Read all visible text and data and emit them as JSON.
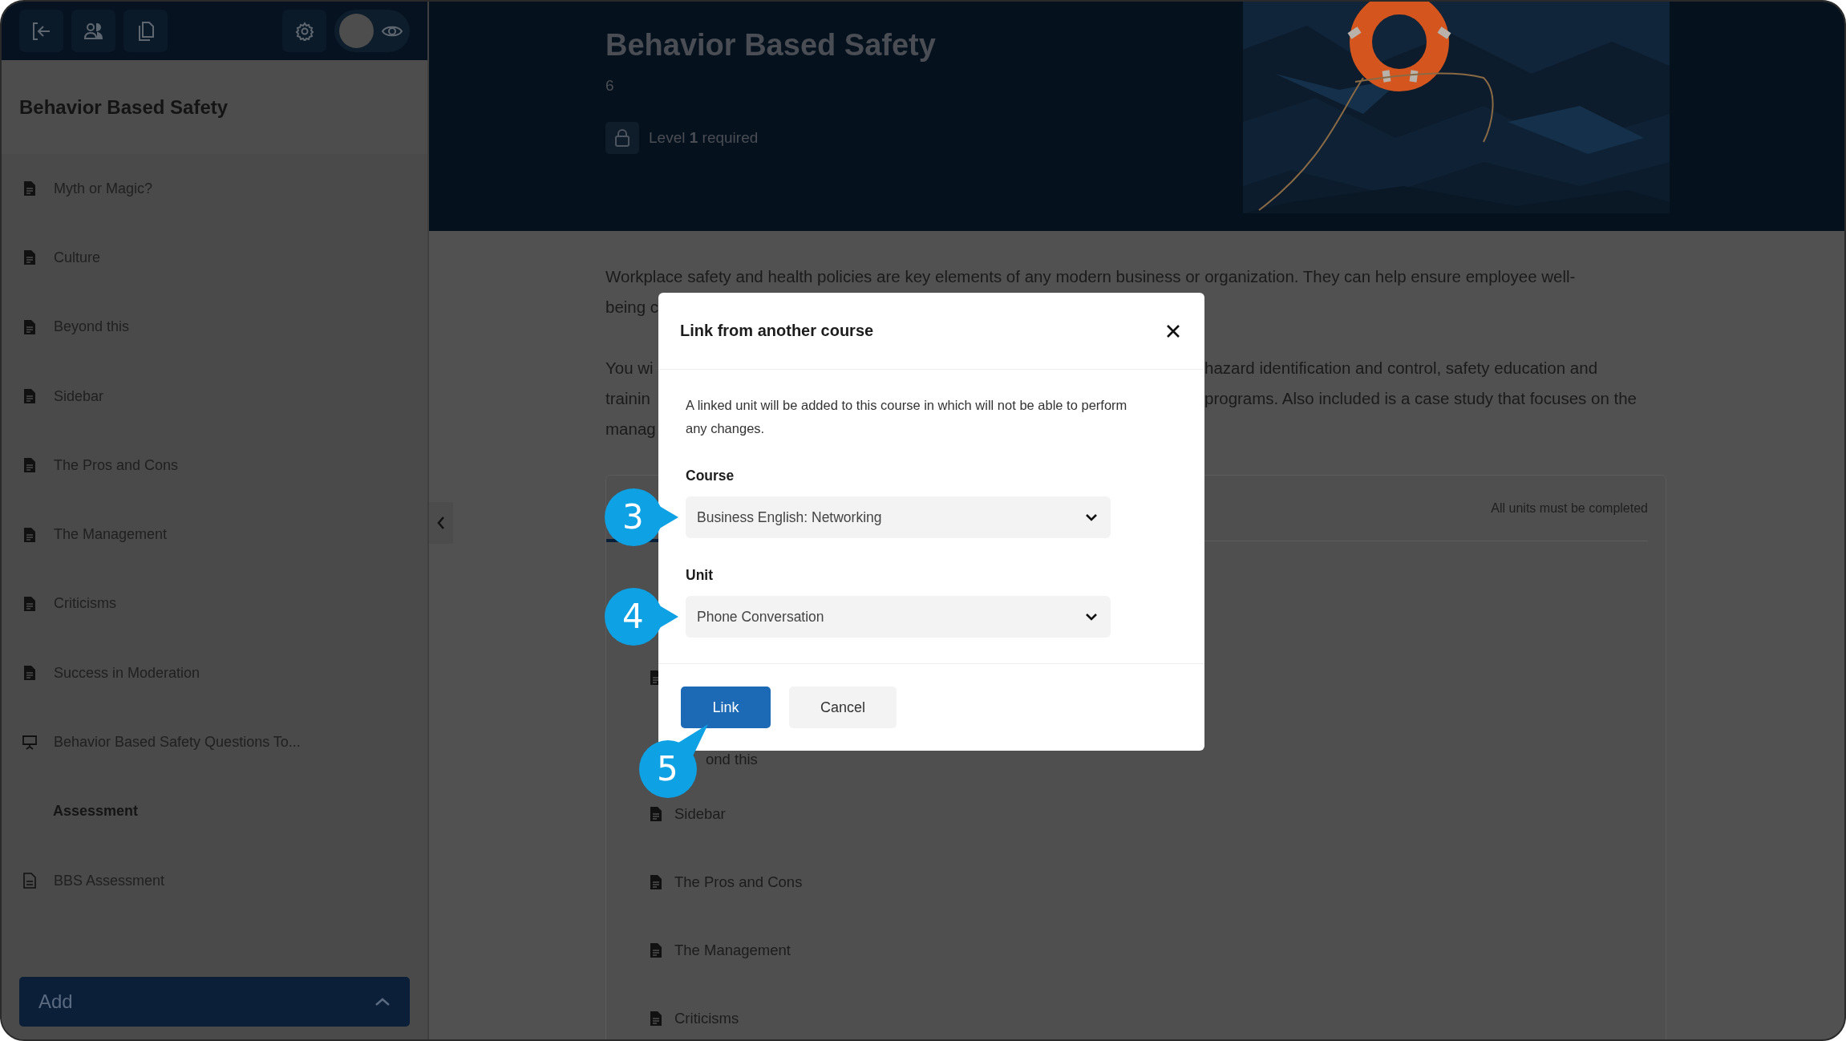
{
  "toolbar": {
    "preview_toggle": {
      "on": false
    }
  },
  "sidebar": {
    "title": "Behavior Based Safety",
    "items": [
      {
        "label": "Myth or Magic?",
        "kind": "page"
      },
      {
        "label": "Culture",
        "kind": "page"
      },
      {
        "label": "Beyond this",
        "kind": "page"
      },
      {
        "label": "Sidebar",
        "kind": "page"
      },
      {
        "label": "The Pros and Cons",
        "kind": "page"
      },
      {
        "label": "The Management",
        "kind": "page"
      },
      {
        "label": "Criticisms",
        "kind": "page"
      },
      {
        "label": "Success in Moderation",
        "kind": "page"
      },
      {
        "label": "Behavior Based Safety Questions To...",
        "kind": "presentation"
      },
      {
        "label": "Assessment",
        "kind": "heading"
      },
      {
        "label": "BBS Assessment",
        "kind": "assessment"
      }
    ],
    "add_button": "Add"
  },
  "banner": {
    "title": "Behavior Based Safety",
    "count": "6",
    "requirement": "Level **1** required"
  },
  "paragraphs": [
    [
      {
        "start": "Workplace safety and health policies are key elements of any modern business or organization. They can help ensure employee well-"
      },
      {
        "start": "being c"
      }
    ],
    [
      {
        "start": "You wi",
        "end": "hazard identification and control, safety education and"
      },
      {
        "start": "trainin",
        "end": "programs. Also included is a case study that focuses on the"
      },
      {
        "start": "manag"
      }
    ]
  ],
  "course_card": {
    "status": "All units must be completed",
    "units": [
      {
        "kind": "page"
      },
      {
        "kind": "page",
        "label": "ond this",
        "covered": true
      },
      {
        "kind": "page",
        "label": "Sidebar"
      },
      {
        "kind": "page",
        "label": "The Pros and Cons"
      },
      {
        "kind": "page",
        "label": "The Management"
      },
      {
        "kind": "page",
        "label": "Criticisms"
      }
    ]
  },
  "dialog": {
    "title": "Link from another course",
    "description": "A linked unit will be added to this course in which will not be able to perform any changes.",
    "fields": [
      {
        "label": "Course",
        "value": "Business English: Networking",
        "callout": "3"
      },
      {
        "label": "Unit",
        "value": "Phone Conversation",
        "callout": "4"
      }
    ],
    "buttons": [
      {
        "label": "Link",
        "kind": "primary",
        "callout": "5"
      },
      {
        "label": "Cancel",
        "kind": "secondary"
      }
    ]
  }
}
